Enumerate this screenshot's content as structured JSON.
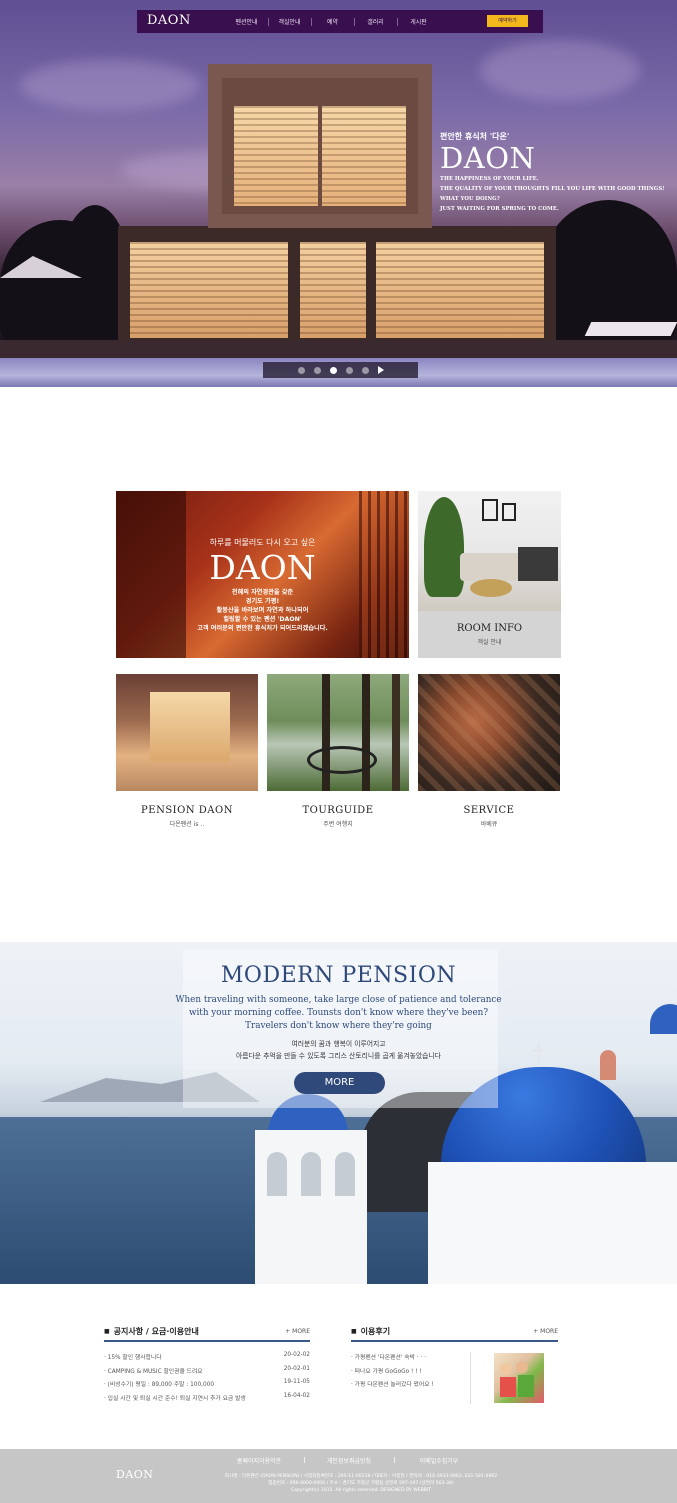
{
  "nav": {
    "logo": "DAON",
    "items": [
      "펜션안내",
      "객실안내",
      "예약",
      "갤러리",
      "게시판"
    ],
    "reserve_label": "예약하기"
  },
  "hero": {
    "subtitle": "편안한 휴식처 '다온'",
    "title": "DAON",
    "tagline": [
      "THE HAPPINESS OF YOUR LIFE.",
      "THE QUALITY OF  YOUR THOUGHTS FILL YOU LIFE WITH GOOD THINGS!",
      "WHAT YOU DOING?",
      "JUST WAITING FOR SPRING TO COME."
    ],
    "slide_count": 5,
    "active_slide": 3
  },
  "feature": {
    "small": "하루를 머물러도 다시 오고 싶은",
    "big": "DAON",
    "desc": [
      "천혜의 자연경관을 갖춘",
      "경기도 가평!",
      "활봉산을 바라보며 자연과 하나되어",
      "힐링할 수 있는 펜션 'DAON'",
      "고객 여러분의 편안한 휴식처가 되어드리겠습니다."
    ]
  },
  "room_info": {
    "title": "ROOM INFO",
    "subtitle": "객실 안내"
  },
  "cards": [
    {
      "title": "PENSION DAON",
      "subtitle": "다온펜션 is .."
    },
    {
      "title": "TOURGUIDE",
      "subtitle": "주변 여행지"
    },
    {
      "title": "SERVICE",
      "subtitle": "바베큐"
    }
  ],
  "modern": {
    "title": "MODERN PENSION",
    "eng": [
      "When traveling with someone, take large close of  patience and tolerance",
      "with your morning coffee. Tounsts don't know where they've been?",
      "Travelers don't know where they're going"
    ],
    "kor": [
      "여러분의 꿈과 행복이 이루어지고",
      "아름다운 추억을 만들 수 있도록 그리스 산토리니를 곱게 옮겨놓았습니다"
    ],
    "more_label": "MORE"
  },
  "notice": {
    "title": "공지사항 / 요금·이용안내",
    "more": "+ MORE",
    "items": [
      {
        "text": "· 15% 할인 행사합니다",
        "date": "20-02-02"
      },
      {
        "text": "· CAMPING & MUSIC 할인권을 드려요",
        "date": "20-02-01"
      },
      {
        "text": "· (비성수기) 평일 : 89,000 주말 : 100,000",
        "date": "19-11-05"
      },
      {
        "text": "· 입실 시간 및 퇴실 시간 준수! 퇴실 지연시 추가 요금 발생",
        "date": "16-04-02"
      }
    ]
  },
  "review": {
    "title": "이용후기",
    "more": "+ MORE",
    "items": [
      "· 가평펜션 '다온펜션' 숙박 · · ·",
      "· 떠나요 가평 GoGoGo ! ! !",
      "· 가평 다온펜션 놀러갔다 왔어요 !"
    ]
  },
  "footer": {
    "logo": "DAON",
    "links": [
      "홈페이지이용약관",
      "개인정보취급방침",
      "이메일수집거부"
    ],
    "info": [
      "회사명 : 다온펜션 (DAON PENSION) / 사업자등록번호 : 295-11-00138 / 대표자 : 이종현 / 연락처 : 010-3933-0962, 031-581-0962",
      "업종번호 : 000-0000-0000 / 주소 : 경기도 가평군 가평읍 상면로 597-197 (상면리 563-34)",
      "Copyright(c) 2015. All rights reserved.  DESIGNED BY WEBBIT"
    ]
  }
}
